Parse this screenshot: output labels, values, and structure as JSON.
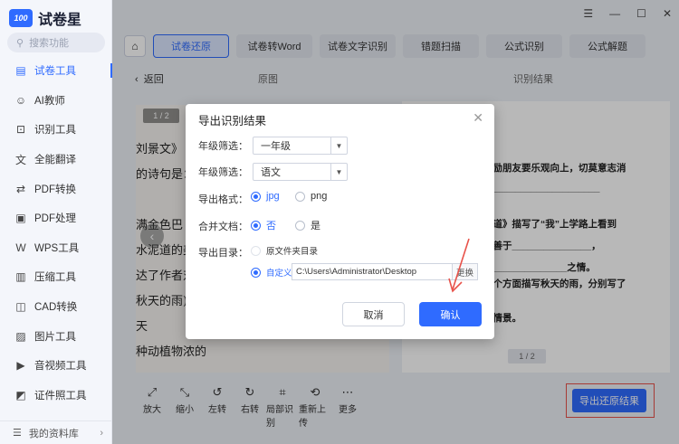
{
  "app": {
    "logo_text": "100",
    "title": "试卷星"
  },
  "search": {
    "placeholder": "搜索功能"
  },
  "window": {
    "menu": "☰",
    "min": "—",
    "max": "☐",
    "close": "✕"
  },
  "sidebar": {
    "items": [
      {
        "label": "试卷工具",
        "icon": "test-icon",
        "glyph": "▤",
        "active": true
      },
      {
        "label": "AI教师",
        "icon": "ai-icon",
        "glyph": "☺",
        "active": false
      },
      {
        "label": "识别工具",
        "icon": "scan-icon",
        "glyph": "⊡",
        "active": false
      },
      {
        "label": "全能翻译",
        "icon": "translate-icon",
        "glyph": "文",
        "active": false
      },
      {
        "label": "PDF转换",
        "icon": "pdf-convert-icon",
        "glyph": "⇄",
        "active": false
      },
      {
        "label": "PDF处理",
        "icon": "pdf-process-icon",
        "glyph": "▣",
        "active": false
      },
      {
        "label": "WPS工具",
        "icon": "wps-icon",
        "glyph": "W",
        "active": false
      },
      {
        "label": "压缩工具",
        "icon": "compress-icon",
        "glyph": "▥",
        "active": false
      },
      {
        "label": "CAD转换",
        "icon": "cad-icon",
        "glyph": "◫",
        "active": false
      },
      {
        "label": "图片工具",
        "icon": "image-icon",
        "glyph": "▨",
        "active": false
      },
      {
        "label": "音视频工具",
        "icon": "video-icon",
        "glyph": "▶",
        "active": false
      },
      {
        "label": "证件照工具",
        "icon": "id-photo-icon",
        "glyph": "◩",
        "active": false
      }
    ],
    "library": "我的资料库"
  },
  "tabs": [
    {
      "label": "试卷还原",
      "active": true
    },
    {
      "label": "试卷转Word",
      "active": false
    },
    {
      "label": "试卷文字识别",
      "active": false
    },
    {
      "label": "错题扫描",
      "active": false
    },
    {
      "label": "公式识别",
      "active": false
    },
    {
      "label": "公式解题",
      "active": false
    }
  ],
  "content": {
    "back": "返回",
    "original": "原图",
    "result": "识别结果"
  },
  "preview": {
    "left_pager": "1 / 2",
    "right_pager": "1 / 2",
    "left_lines": [
      "刘景文》",
      "的诗句是：",
      "",
      "满金色巴",
      "水泥道的美",
      "达了作者对",
      "秋天的雨)",
      "天",
      "种动植物浓的"
    ],
    "right_lines": [
      "勉励朋友要乐观向上，切莫意志消",
      "______________________",
      "",
      "泥道》描写了“我”上学路上看到",
      "要善于_______________，",
      "的______________之情。",
      "三个方面描写秋天的雨，分别写了",
      "",
      "的情景。"
    ]
  },
  "toolbar": [
    {
      "label": "放大",
      "icon": "zoom-in-icon",
      "glyph": "⤢"
    },
    {
      "label": "缩小",
      "icon": "zoom-out-icon",
      "glyph": "⤡"
    },
    {
      "label": "左转",
      "icon": "rotate-left-icon",
      "glyph": "↺"
    },
    {
      "label": "右转",
      "icon": "rotate-right-icon",
      "glyph": "↻"
    },
    {
      "label": "局部识别",
      "icon": "crop-icon",
      "glyph": "⌗"
    },
    {
      "label": "重新上传",
      "icon": "reupload-icon",
      "glyph": "⟲"
    },
    {
      "label": "更多",
      "icon": "more-icon",
      "glyph": "⋯"
    }
  ],
  "export_button": "导出还原结果",
  "dialog": {
    "title": "导出识别结果",
    "grade_label": "年级筛选：",
    "grade_value": "一年级",
    "subject_label": "年级筛选：",
    "subject_value": "语文",
    "format_label": "导出格式：",
    "format_options": [
      "jpg",
      "png"
    ],
    "format_selected": "jpg",
    "merge_label": "合并文档：",
    "merge_options": [
      "否",
      "是"
    ],
    "merge_selected": "否",
    "dir_label": "导出目录：",
    "dir_option_source": "原文件夹目录",
    "dir_option_custom": "自定义",
    "dir_path": "C:\\Users\\Administrator\\Desktop",
    "browse": "更换",
    "cancel": "取消",
    "confirm": "确认"
  },
  "colors": {
    "accent": "#2f6bff",
    "highlight": "#e8524a"
  }
}
